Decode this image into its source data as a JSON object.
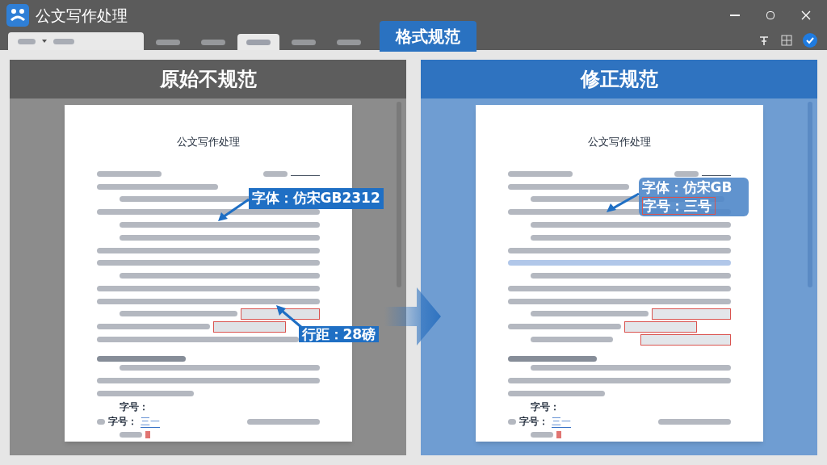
{
  "window": {
    "title": "公文写作处理"
  },
  "ribbon": {
    "tabs": [
      {
        "selected": false
      },
      {
        "selected": false
      },
      {
        "selected": true
      },
      {
        "selected": false
      },
      {
        "selected": false
      }
    ],
    "highlight_tab": "格式规范"
  },
  "panels": [
    {
      "kind": "before",
      "header": "原始不规范",
      "doc_title": "公文写作处理",
      "signature_label": "字号：",
      "number_label": "字号：",
      "number_value": "三一",
      "callouts": [
        {
          "kind": "font",
          "lines": [
            "字体：仿宋GB2312"
          ]
        },
        {
          "kind": "spacing",
          "lines": [
            "行距：28磅"
          ]
        }
      ]
    },
    {
      "kind": "after",
      "header": "修正规范",
      "doc_title": "公文写作处理",
      "signature_label": "字号：",
      "number_label": "字号：",
      "number_value": "三一",
      "callouts": [
        {
          "kind": "combined",
          "lines": [
            "字体：仿宋GB",
            "字号：三号"
          ]
        }
      ]
    }
  ]
}
